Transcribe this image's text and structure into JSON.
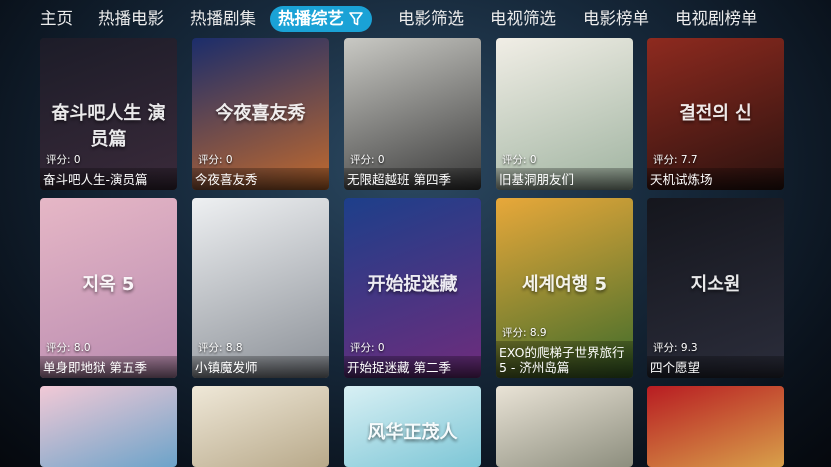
{
  "nav": {
    "tabs": [
      "主页",
      "热播电影",
      "热播剧集",
      "热播综艺",
      "电影筛选",
      "电视筛选",
      "电影榜单",
      "电视剧榜单"
    ],
    "active_index": 3,
    "active_icon": "filter-icon"
  },
  "rating_prefix": "评分:",
  "rows": [
    [
      {
        "title": "奋斗吧人生-演员篇",
        "rating": "0",
        "poster_text": "奋斗吧人生 演员篇",
        "colors": [
          "#1c1c28",
          "#3a2a3a"
        ]
      },
      {
        "title": "今夜喜友秀",
        "rating": "0",
        "poster_text": "今夜喜友秀",
        "colors": [
          "#1b2d6b",
          "#c26a2d"
        ]
      },
      {
        "title": "无限超越班 第四季",
        "rating": "0",
        "poster_text": "",
        "colors": [
          "#c9c9c4",
          "#3a3a3a"
        ]
      },
      {
        "title": "旧基洞朋友们",
        "rating": "0",
        "poster_text": "",
        "colors": [
          "#f1eee6",
          "#9fb3a0"
        ]
      },
      {
        "title": "天机试炼场",
        "rating": "7.7",
        "poster_text": "결전의 신",
        "colors": [
          "#8e2a1f",
          "#2a120f"
        ]
      }
    ],
    [
      {
        "title": "单身即地狱 第五季",
        "rating": "8.0",
        "poster_text": "지옥 5",
        "colors": [
          "#e6b7c6",
          "#b98bb0"
        ]
      },
      {
        "title": "小镇魔发师",
        "rating": "8.8",
        "poster_text": "",
        "colors": [
          "#eef0f2",
          "#8a8f96"
        ]
      },
      {
        "title": "开始捉迷藏 第二季",
        "rating": "0",
        "poster_text": "开始捉迷藏",
        "colors": [
          "#1d3f8a",
          "#6f2c7c"
        ]
      },
      {
        "title": "EXO的爬梯子世界旅行5 - 济州岛篇",
        "rating": "8.9",
        "poster_text": "세계여행 5",
        "colors": [
          "#e8a83a",
          "#3d6b2a"
        ]
      },
      {
        "title": "四个愿望",
        "rating": "9.3",
        "poster_text": "지소원",
        "colors": [
          "#15161d",
          "#2b2d3b"
        ]
      }
    ],
    [
      {
        "title": "",
        "rating": "",
        "poster_text": "",
        "colors": [
          "#f2c9d6",
          "#6ca3c9"
        ]
      },
      {
        "title": "",
        "rating": "",
        "poster_text": "",
        "colors": [
          "#efe8d8",
          "#b8a98a"
        ]
      },
      {
        "title": "",
        "rating": "",
        "poster_text": "风华正茂人",
        "colors": [
          "#d8f0f4",
          "#7dc6d6"
        ]
      },
      {
        "title": "",
        "rating": "",
        "poster_text": "",
        "colors": [
          "#e9e3d6",
          "#8d8e7e"
        ]
      },
      {
        "title": "",
        "rating": "",
        "poster_text": "",
        "colors": [
          "#b81c22",
          "#d8a04a"
        ]
      }
    ]
  ]
}
